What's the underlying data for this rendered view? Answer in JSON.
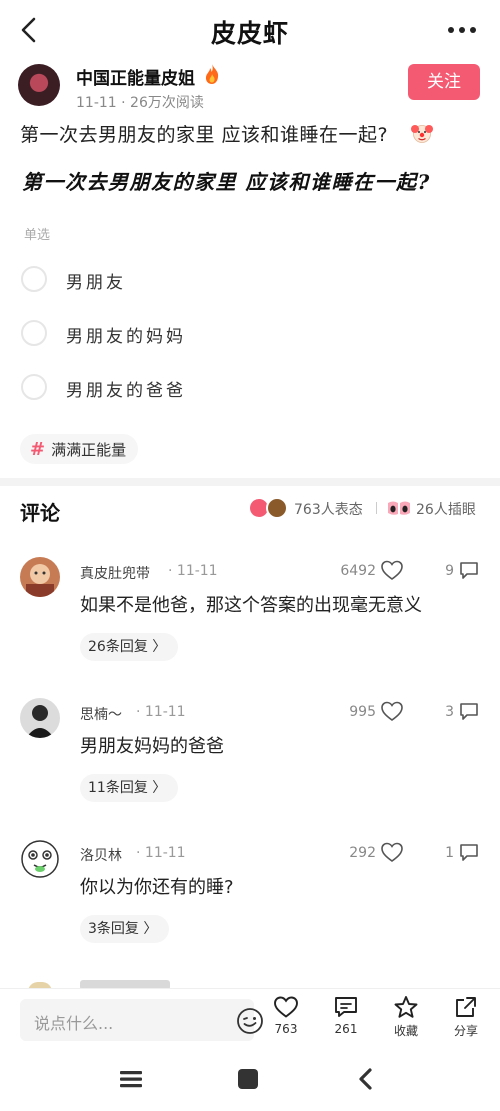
{
  "header": {
    "title": "皮皮虾"
  },
  "author": {
    "name": "中国正能量皮姐",
    "date": "11-11",
    "views": "26万次阅读",
    "follow_label": "关注"
  },
  "post": {
    "title": "第一次去男朋友的家里 应该和谁睡在一起?",
    "image_text": "第一次去男朋友的家里 应该和谁睡在一起?",
    "vote_type": "单选",
    "options": [
      "男朋友",
      "男朋友的妈妈",
      "男朋友的爸爸"
    ],
    "tag": "满满正能量"
  },
  "comments_header": {
    "title": "评论",
    "reactions": "763人表态",
    "inserts": "26人插眼"
  },
  "comments": [
    {
      "name": "真皮肚兜带",
      "date": "11-11",
      "likes": "6492",
      "replies": "9",
      "text": "如果不是他爸，那这个答案的出现毫无意义",
      "more": "26条回复 〉"
    },
    {
      "name": "思楠～",
      "date": "11-11",
      "likes": "995",
      "replies": "3",
      "text": "男朋友妈妈的爸爸",
      "more": "11条回复 〉"
    },
    {
      "name": "洛贝林",
      "date": "11-11",
      "likes": "292",
      "replies": "1",
      "text": "你以为你还有的睡?",
      "more": "3条回复 〉"
    }
  ],
  "bottom_bar": {
    "input_placeholder": "说点什么...",
    "like_count": "763",
    "comment_count": "261",
    "favorite_label": "收藏",
    "share_label": "分享"
  },
  "colors": {
    "accent": "#f45b73"
  }
}
